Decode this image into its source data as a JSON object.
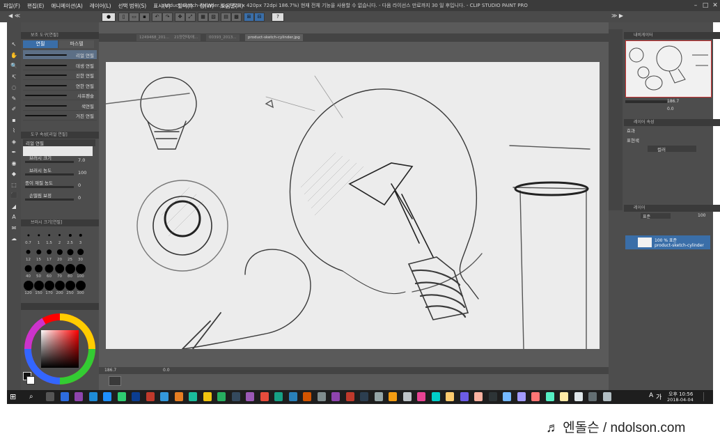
{
  "app": {
    "title": "product-sketch-cylinder.jpg (720 x 420px 72dpi 186.7%)  현재 전체 기능을 사용할 수 없습니다. - 다음 라이선스 만료까지 30 일 후입니다. - CLIP STUDIO PAINT PRO"
  },
  "menu": [
    "파일(F)",
    "편집(E)",
    "애니메이션(A)",
    "레이어(L)",
    "선택 범위(S)",
    "표시(V)",
    "필터(I)",
    "창(W)",
    "도움말(H)"
  ],
  "tabs": [
    "1249468_201...",
    "21양현태/애...",
    "00393_2013...",
    "product-sketch-cylinder.jpg"
  ],
  "tool_panel": {
    "subtool_header": "보조 도구[연필]",
    "tab_pencil": "연필",
    "tab_pastel": "파스텔",
    "brushes": [
      "리얼 연필",
      "데생 연필",
      "진한 연필",
      "연한 연필",
      "샤프펜슬",
      "색연필",
      "거친 연필"
    ]
  },
  "tool_property": {
    "header": "도구 속성[리얼 연필]",
    "name": "리얼 연필",
    "rows": [
      {
        "label": "브러시 크기",
        "value": "7.0"
      },
      {
        "label": "브러시 농도",
        "value": "100"
      },
      {
        "label": "종이 재질 농도",
        "value": "0"
      },
      {
        "label": "손떨림 보정",
        "value": "0"
      }
    ]
  },
  "brush_size": {
    "header": "브러시 크기[연필]",
    "sizes": [
      "0.7",
      "1",
      "1.5",
      "2",
      "2.5",
      "3",
      "",
      "12",
      "15",
      "17",
      "20",
      "25",
      "30",
      "",
      "40",
      "50",
      "60",
      "70",
      "80",
      "100",
      "",
      "120",
      "150",
      "170",
      "200",
      "250",
      "300"
    ]
  },
  "status": {
    "zoom": "186.7",
    "extra": "0.0"
  },
  "navigator": {
    "header": "내비게이터",
    "zoom": "186.7",
    "angle": "0.0"
  },
  "layer_property": {
    "header": "레이어 속성",
    "effect_label": "효과",
    "color_label": "표현색",
    "color_value": "컬러"
  },
  "layers": {
    "header": "레이어",
    "blend": "표준",
    "opacity": "100",
    "layer_percent": "100 % 표준",
    "layer_name": "product-sketch-cylinder"
  },
  "clock": {
    "time": "오후 10:56",
    "date": "2018-04-04"
  },
  "watermark": "♬ 엔돌슨 / ndolson.com",
  "colors": {
    "chrome": "#4d4d4d",
    "canvas": "#ececec",
    "accent": "#3a6ea8"
  }
}
